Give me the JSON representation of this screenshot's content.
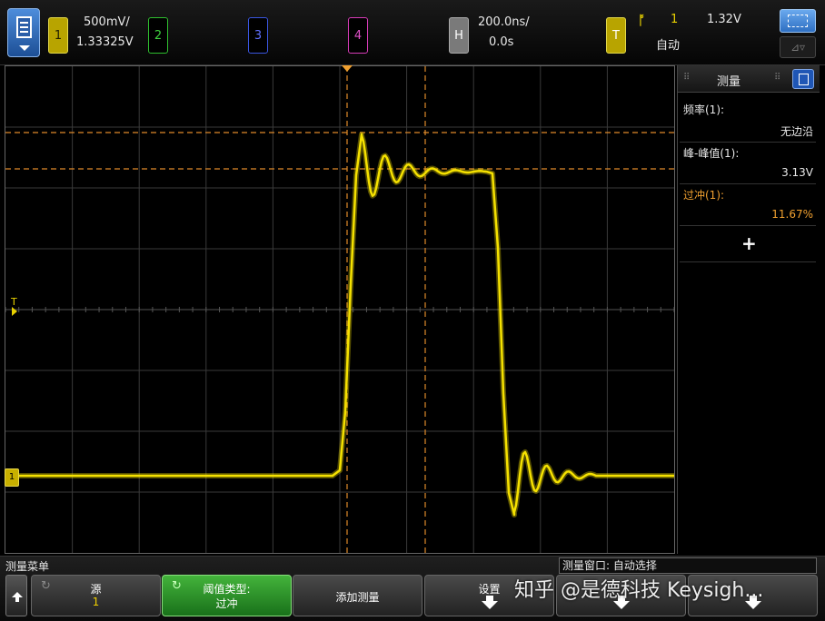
{
  "top_bar": {
    "ch1": {
      "label": "1",
      "scale": "500mV/",
      "offset": "1.33325V"
    },
    "ch2": {
      "label": "2"
    },
    "ch3": {
      "label": "3"
    },
    "ch4": {
      "label": "4"
    },
    "horizontal": {
      "label": "H",
      "scale": "200.0ns/",
      "delay": "0.0s"
    },
    "trigger": {
      "label": "T",
      "edge_icon": "rising-edge-icon",
      "source": "1",
      "level": "1.32V",
      "mode": "自动"
    }
  },
  "graticule": {
    "trigger_marker": "T",
    "ground_marker": "1",
    "colors": {
      "ch1": "#f5e100",
      "cursor": "#e08a2a",
      "grid": "#555555"
    }
  },
  "measurements": {
    "title": "测量",
    "items": [
      {
        "label": "频率(1):",
        "value": "无边沿",
        "highlight": false
      },
      {
        "label": "峰-峰值(1):",
        "value": "3.13V",
        "highlight": false
      },
      {
        "label": "过冲(1):",
        "value": "11.67%",
        "highlight": true
      }
    ],
    "add_symbol": "+"
  },
  "bottom_bar": {
    "menu_title": "测量菜单",
    "measurement_window": "测量窗口: 自动选择",
    "softkeys": [
      {
        "line1": "源",
        "line2": "1"
      },
      {
        "line1": "阈值类型:",
        "line2": "过冲"
      },
      {
        "label": "添加测量"
      },
      {
        "label": "设置"
      },
      {
        "label": ""
      },
      {
        "label": ""
      }
    ]
  },
  "watermark": "知乎 @是德科技 Keysigh..."
}
